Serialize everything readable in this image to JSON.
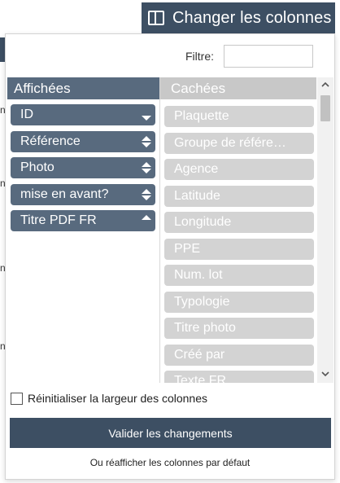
{
  "trigger": {
    "label": "Changer les colonnes",
    "icon": "columns-icon"
  },
  "filter": {
    "label": "Filtre:",
    "value": "",
    "placeholder": ""
  },
  "shown": {
    "header": "Affichées",
    "items": [
      {
        "label": "ID",
        "sort": "down"
      },
      {
        "label": "Référence",
        "sort": "both"
      },
      {
        "label": "Photo",
        "sort": "both"
      },
      {
        "label": "mise en avant?",
        "sort": "both"
      },
      {
        "label": "Titre PDF FR",
        "sort": "up"
      }
    ]
  },
  "hidden": {
    "header": "Cachées",
    "items": [
      "Plaquette",
      "Groupe de référe…",
      "Agence",
      "Latitude",
      "Longitude",
      "PPE",
      "Num. lot",
      "Typologie",
      "Titre photo",
      "Créé par",
      "Texte FR"
    ]
  },
  "reset": {
    "label": "Réinitialiser la largeur des colonnes",
    "checked": false
  },
  "validate": {
    "label": "Valider les changements"
  },
  "default_link": {
    "label": "Ou réafficher les colonnes par défaut"
  },
  "colors": {
    "dark": "#3d4f63",
    "shown_item": "#586a7e",
    "hidden_item": "#d3d3d3"
  }
}
